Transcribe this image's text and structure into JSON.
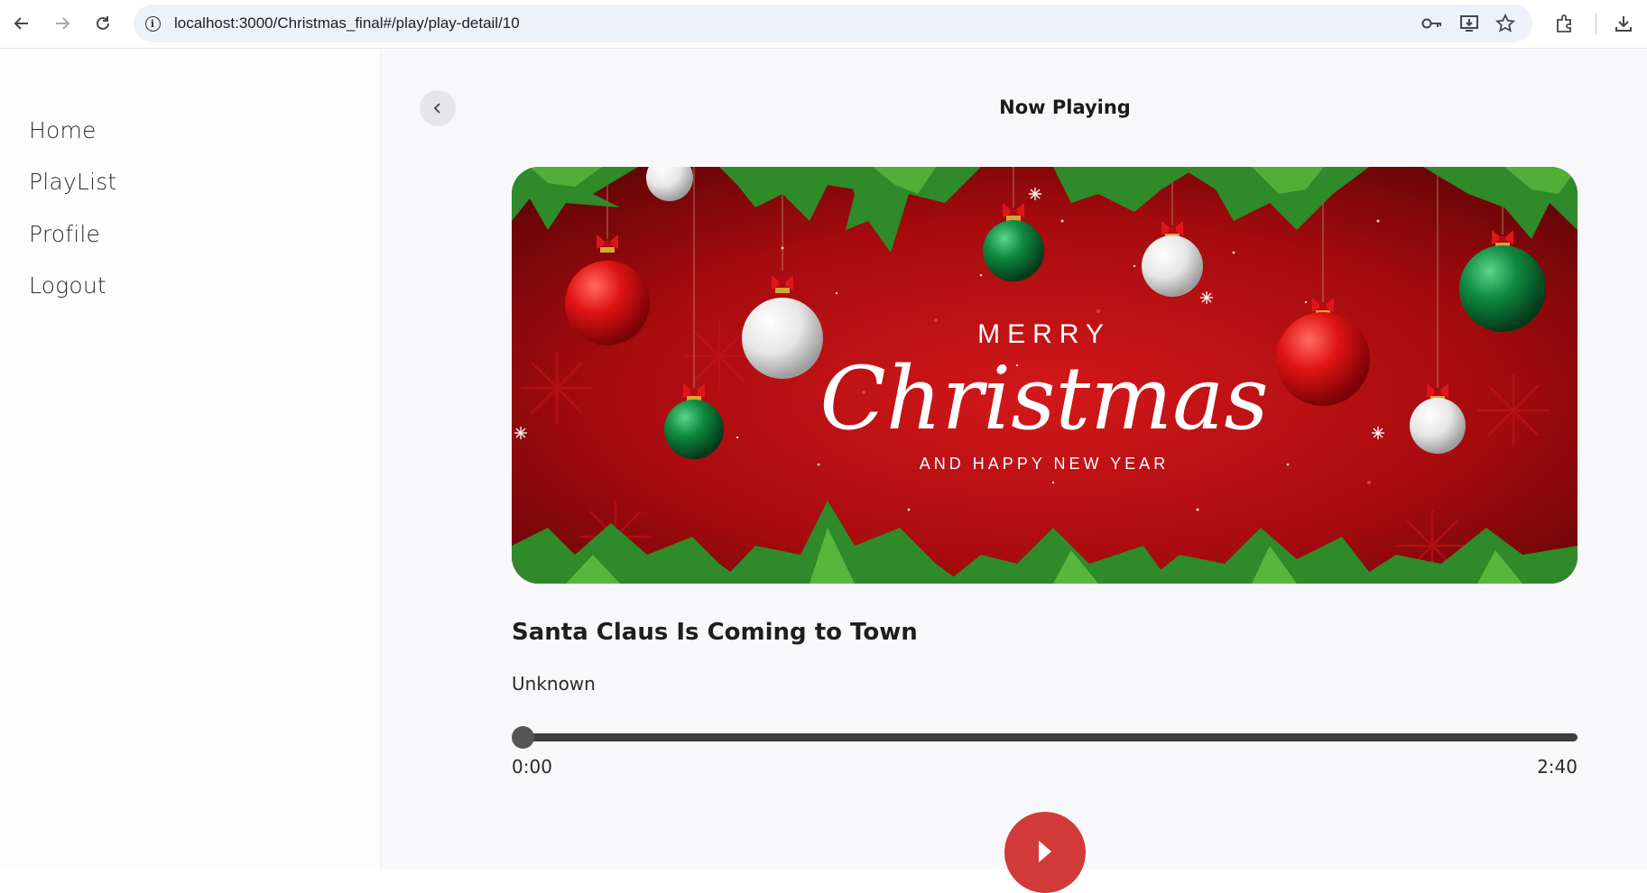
{
  "browser": {
    "url": "localhost:3000/Christmas_final#/play/play-detail/10",
    "icons": [
      "back-icon",
      "forward-icon",
      "reload-icon",
      "site-info-icon",
      "password-key-icon",
      "install-app-icon",
      "bookmark-star-icon",
      "extensions-icon",
      "downloads-icon"
    ]
  },
  "sidebar": {
    "items": [
      {
        "label": "Home"
      },
      {
        "label": "PlayList"
      },
      {
        "label": "Profile"
      },
      {
        "label": "Logout"
      }
    ]
  },
  "main": {
    "title": "Now Playing",
    "cover": {
      "line1": "MERRY",
      "line2": "Christmas",
      "line3": "AND HAPPY NEW YEAR"
    },
    "song": {
      "title": "Santa Claus Is Coming to Town",
      "artist": "Unknown"
    },
    "player": {
      "current_time": "0:00",
      "total_time": "2:40",
      "progress": 0
    }
  },
  "colors": {
    "play_button": "#d23a3a",
    "cover_red": "#b30c10",
    "ornament_green": "#0f7a3a"
  }
}
